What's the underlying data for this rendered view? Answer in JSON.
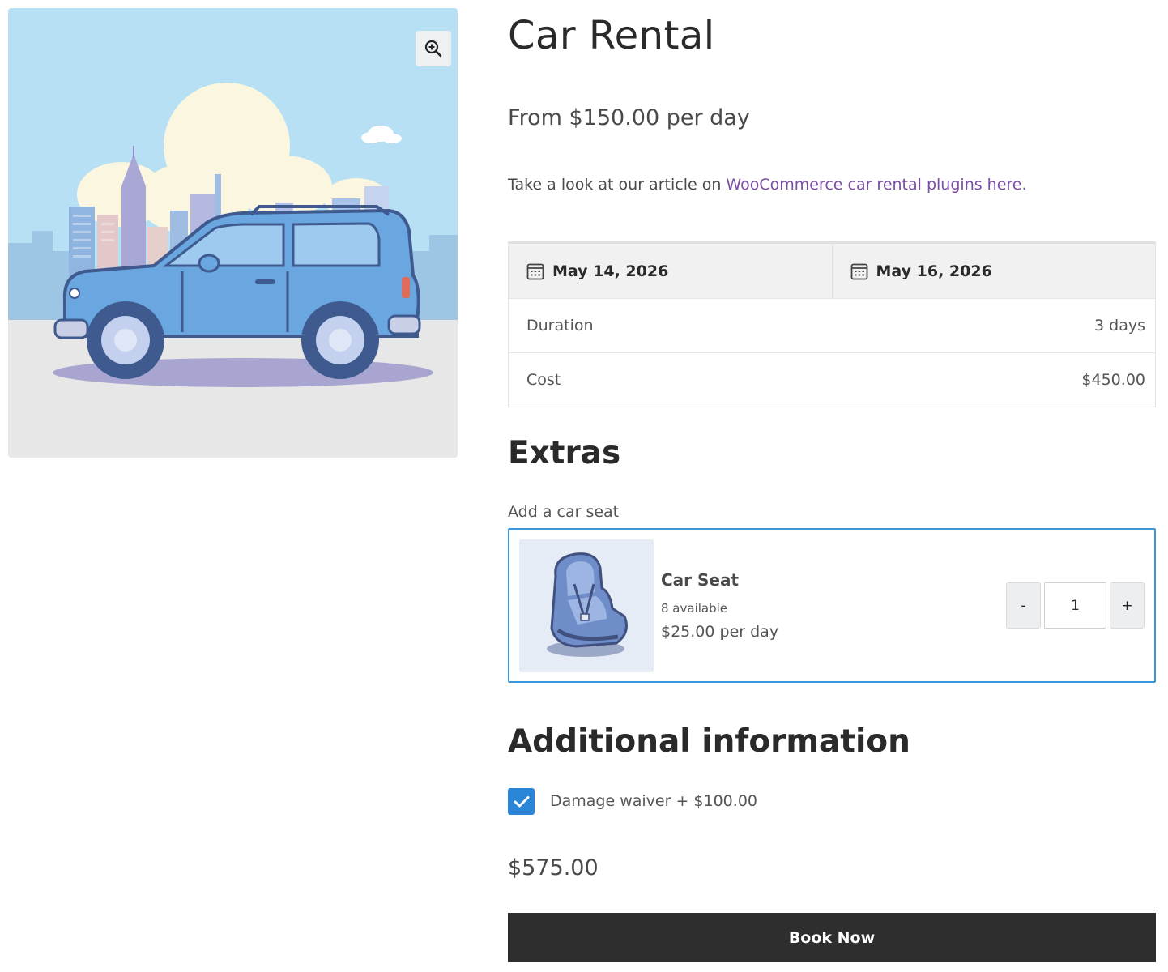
{
  "product": {
    "title": "Car Rental",
    "price_from": "From $150.00 per day",
    "article_prefix": "Take a look at our article on ",
    "article_link": "WooCommerce car rental plugins here.",
    "image_icon": "car-illustration"
  },
  "booking": {
    "start_date": "May 14, 2026",
    "end_date": "May 16, 2026",
    "duration_label": "Duration",
    "duration_value": "3 days",
    "cost_label": "Cost",
    "cost_value": "$450.00"
  },
  "extras": {
    "title": "Extras",
    "label": "Add a car seat",
    "item": {
      "name": "Car Seat",
      "availability": "8 available",
      "price": "$25.00 per day",
      "quantity": "1",
      "minus_label": "-",
      "plus_label": "+"
    }
  },
  "additional": {
    "title": "Additional information",
    "damage_waiver_label": "Damage waiver + $100.00",
    "damage_waiver_checked": true
  },
  "total": "$575.00",
  "book_button": "Book Now",
  "colors": {
    "link": "#7a4ea3",
    "accent_blue": "#2b85d6",
    "button_dark": "#2e2e2e"
  }
}
